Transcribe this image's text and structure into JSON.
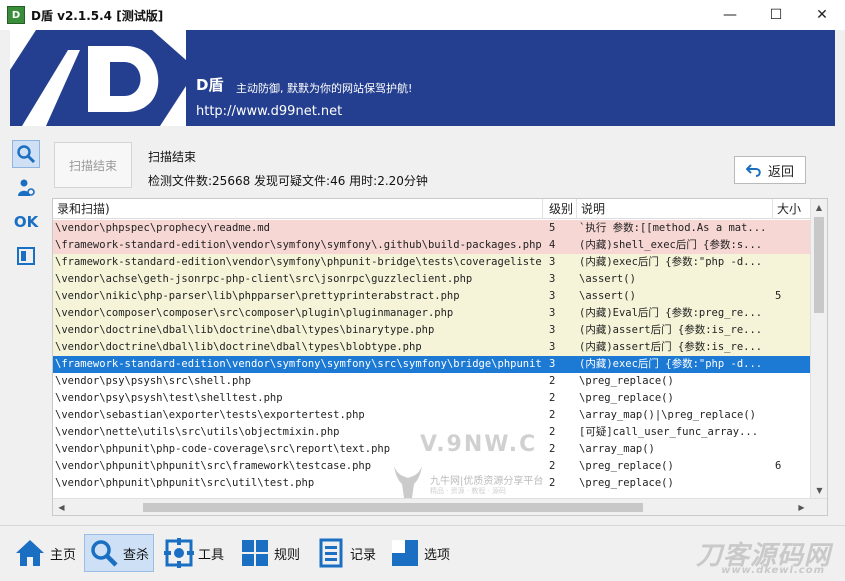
{
  "window": {
    "icon_label": "D",
    "title": "D盾 v2.1.5.4 [测试版]",
    "minimize_glyph": "—",
    "maximize_glyph": "☐",
    "close_glyph": "✕"
  },
  "banner": {
    "brand": "D盾",
    "slogan": "主动防御, 默默为你的网站保驾护航!",
    "url": "http://www.d99net.net",
    "colors": {
      "background": "#243f8f"
    }
  },
  "left_nav": [
    {
      "icon": "magnifier-icon",
      "glyph": "🔍",
      "active": true
    },
    {
      "icon": "user-gear-icon",
      "glyph": "♝",
      "active": false
    },
    {
      "icon": "ok-icon",
      "glyph": "OK",
      "active": false
    },
    {
      "icon": "window-icon",
      "glyph": "◫",
      "active": false
    }
  ],
  "scan": {
    "button_label": "扫描结束",
    "status": "扫描结束",
    "summary": "检测文件数:25668 发现可疑文件:46 用时:2.20分钟",
    "back_label": "返回"
  },
  "table": {
    "columns": [
      "录和扫描)",
      "级别",
      "说明",
      "大小"
    ],
    "rows": [
      {
        "path": "\\vendor\\phpspec\\prophecy\\readme.md",
        "level": "5",
        "desc": "`执行 参数:[[method.As a mat...",
        "size": "",
        "tone": "red"
      },
      {
        "path": "\\framework-standard-edition\\vendor\\symfony\\symfony\\.github\\build-packages.php",
        "level": "4",
        "desc": "(内藏)shell_exec后门 {参数:s...",
        "size": "",
        "tone": "red"
      },
      {
        "path": "\\framework-standard-edition\\vendor\\symfony\\phpunit-bridge\\tests\\coveragelisten...",
        "level": "3",
        "desc": "(内藏)exec后门 {参数:\"php -d...",
        "size": "",
        "tone": "yellow"
      },
      {
        "path": "\\vendor\\achse\\geth-jsonrpc-php-client\\src\\jsonrpc\\guzzleclient.php",
        "level": "3",
        "desc": "\\assert()",
        "size": "",
        "tone": "yellow"
      },
      {
        "path": "\\vendor\\nikic\\php-parser\\lib\\phpparser\\prettyprinterabstract.php",
        "level": "3",
        "desc": "\\assert()",
        "size": "5",
        "tone": "yellow"
      },
      {
        "path": "\\vendor\\composer\\composer\\src\\composer\\plugin\\pluginmanager.php",
        "level": "3",
        "desc": "(内藏)Eval后门 {参数:preg_re...",
        "size": "",
        "tone": "yellow"
      },
      {
        "path": "\\vendor\\doctrine\\dbal\\lib\\doctrine\\dbal\\types\\binarytype.php",
        "level": "3",
        "desc": "(内藏)assert后门 {参数:is_re...",
        "size": "",
        "tone": "yellow"
      },
      {
        "path": "\\vendor\\doctrine\\dbal\\lib\\doctrine\\dbal\\types\\blobtype.php",
        "level": "3",
        "desc": "(内藏)assert后门 {参数:is_re...",
        "size": "",
        "tone": "yellow"
      },
      {
        "path": "\\framework-standard-edition\\vendor\\symfony\\symfony\\src\\symfony\\bridge\\phpunit\\...",
        "level": "3",
        "desc": "(内藏)exec后门 {参数:\"php -d...",
        "size": "",
        "tone": "sel"
      },
      {
        "path": "\\vendor\\psy\\psysh\\src\\shell.php",
        "level": "2",
        "desc": "\\preg_replace()",
        "size": "",
        "tone": "white"
      },
      {
        "path": "\\vendor\\psy\\psysh\\test\\shelltest.php",
        "level": "2",
        "desc": "\\preg_replace()",
        "size": "",
        "tone": "white"
      },
      {
        "path": "\\vendor\\sebastian\\exporter\\tests\\exportertest.php",
        "level": "2",
        "desc": "\\array_map()|\\preg_replace()",
        "size": "",
        "tone": "white"
      },
      {
        "path": "\\vendor\\nette\\utils\\src\\utils\\objectmixin.php",
        "level": "2",
        "desc": "[可疑]call_user_func_array...",
        "size": "",
        "tone": "white"
      },
      {
        "path": "\\vendor\\phpunit\\php-code-coverage\\src\\report\\text.php",
        "level": "2",
        "desc": "\\array_map()",
        "size": "",
        "tone": "white"
      },
      {
        "path": "\\vendor\\phpunit\\phpunit\\src\\framework\\testcase.php",
        "level": "2",
        "desc": "\\preg_replace()",
        "size": "6",
        "tone": "white"
      },
      {
        "path": "\\vendor\\phpunit\\phpunit\\src\\util\\test.php",
        "level": "2",
        "desc": "\\preg_replace()",
        "size": "",
        "tone": "white"
      }
    ]
  },
  "watermark": {
    "big": "V.9NW.C",
    "small": "九牛网|优质资源分享平台",
    "tagline": "精品 · 资源 · 教程 · 源码"
  },
  "bottom_nav": [
    {
      "id": "home",
      "label": "主页",
      "icon": "home-icon",
      "active": false
    },
    {
      "id": "scan",
      "label": "查杀",
      "icon": "search-icon",
      "active": true
    },
    {
      "id": "tools",
      "label": "工具",
      "icon": "gear-frame-icon",
      "active": false
    },
    {
      "id": "rules",
      "label": "规则",
      "icon": "grid-icon",
      "active": false
    },
    {
      "id": "log",
      "label": "记录",
      "icon": "document-icon",
      "active": false
    },
    {
      "id": "options",
      "label": "选项",
      "icon": "option-panel-icon",
      "active": false
    }
  ],
  "corner_watermark": {
    "text": "刀客源码网",
    "sub": "www.dkewl.com"
  }
}
